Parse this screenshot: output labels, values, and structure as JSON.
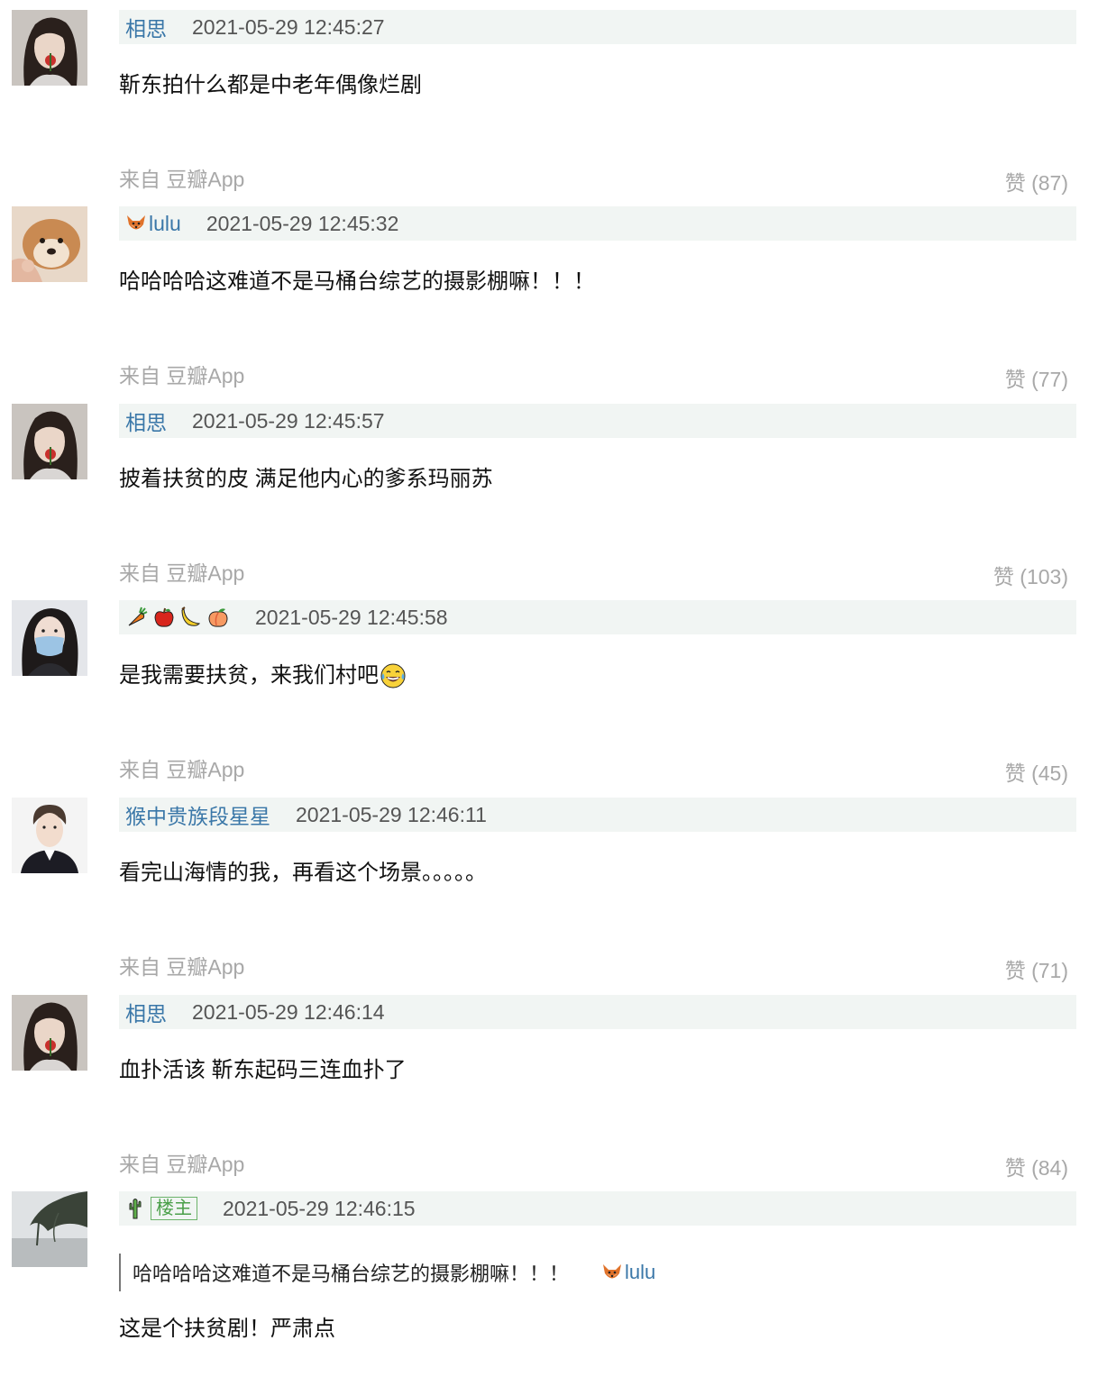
{
  "comments": [
    {
      "username": "相思",
      "timestamp": "2021-05-29 12:45:27",
      "text": "靳东拍什么都是中老年偶像烂剧",
      "source": "来自 豆瓣App",
      "likes": "赞 (87)",
      "avatar_icon": "avatar-woman-flower-icon"
    },
    {
      "username": "lulu",
      "username_icon": "fox-icon",
      "timestamp": "2021-05-29 12:45:32",
      "text": "哈哈哈哈这难道不是马桶台综艺的摄影棚嘛！！！",
      "source": "来自 豆瓣App",
      "likes": "赞 (77)",
      "avatar_icon": "avatar-dog-icon"
    },
    {
      "username": "相思",
      "timestamp": "2021-05-29 12:45:57",
      "text": "披着扶贫的皮 满足他内心的爹系玛丽苏",
      "source": "来自 豆瓣App",
      "likes": "赞 (103)",
      "avatar_icon": "avatar-woman-flower-icon"
    },
    {
      "username_icons": [
        "carrot-icon",
        "apple-icon",
        "banana-icon",
        "peach-icon"
      ],
      "timestamp": "2021-05-29 12:45:58",
      "text": "是我需要扶贫，来我们村吧",
      "text_emoji": "tears-of-joy-emoji",
      "source": "来自 豆瓣App",
      "likes": "赞 (45)",
      "avatar_icon": "avatar-masked-woman-icon"
    },
    {
      "username": "猴中贵族段星星",
      "timestamp": "2021-05-29 12:46:11",
      "text": "看完山海情的我，再看这个场景。。。。。",
      "source": "来自 豆瓣App",
      "likes": "赞 (71)",
      "avatar_icon": "avatar-young-man-icon"
    },
    {
      "username": "相思",
      "timestamp": "2021-05-29 12:46:14",
      "text": "血扑活该 靳东起码三连血扑了",
      "source": "来自 豆瓣App",
      "likes": "赞 (84)",
      "avatar_icon": "avatar-woman-flower-icon"
    },
    {
      "username_icon": "cactus-icon",
      "badge": "楼主",
      "timestamp": "2021-05-29 12:46:15",
      "quote": {
        "text": "哈哈哈哈这难道不是马桶台综艺的摄影棚嘛！！！",
        "author": "lulu",
        "author_icon": "fox-icon"
      },
      "text": "这是个扶贫剧！严肃点",
      "avatar_icon": "avatar-tree-landscape-icon"
    }
  ],
  "colors": {
    "username": "#3a77a8",
    "header_background": "#f1f5f3",
    "meta_gray": "#a8a8a8",
    "badge_green": "#4a9f49"
  }
}
